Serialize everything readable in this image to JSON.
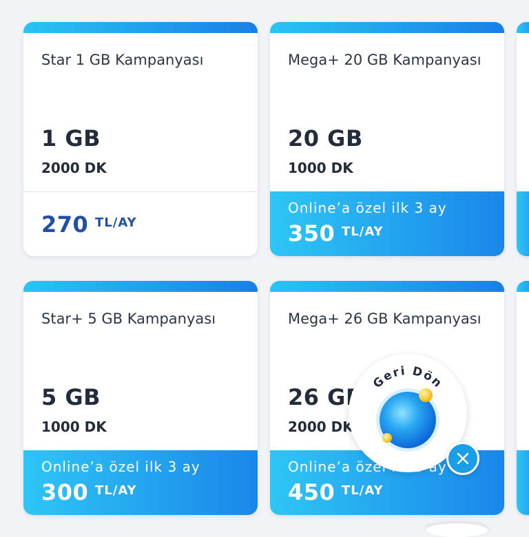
{
  "cards": [
    {
      "title": "Star 1 GB Kampanyası",
      "data": "1 GB",
      "minutes": "2000 DK",
      "promo": "",
      "price": "270",
      "unit": "TL/AY"
    },
    {
      "title": "Mega+ 20 GB Kampanyası",
      "data": "20 GB",
      "minutes": "1000 DK",
      "promo": "Online’a özel ilk 3 ay",
      "price": "350",
      "unit": "TL/AY"
    },
    {
      "title": "Star+ 5 GB Kampanyası",
      "data": "5 GB",
      "minutes": "1000 DK",
      "promo": "Online’a özel ilk 3 ay",
      "price": "300",
      "unit": "TL/AY"
    },
    {
      "title": "Mega+ 26 GB Kampanyası",
      "data": "26 GB",
      "minutes": "2000 DK",
      "promo": "Online’a özel ilk 3 ay",
      "price": "450",
      "unit": "TL/AY"
    }
  ],
  "widget": {
    "label": "Geri Dön",
    "close_icon": "close-icon"
  },
  "colors": {
    "accent_start": "#29c4f4",
    "accent_end": "#1a7fe6",
    "price_blue": "#1f4fa6"
  }
}
